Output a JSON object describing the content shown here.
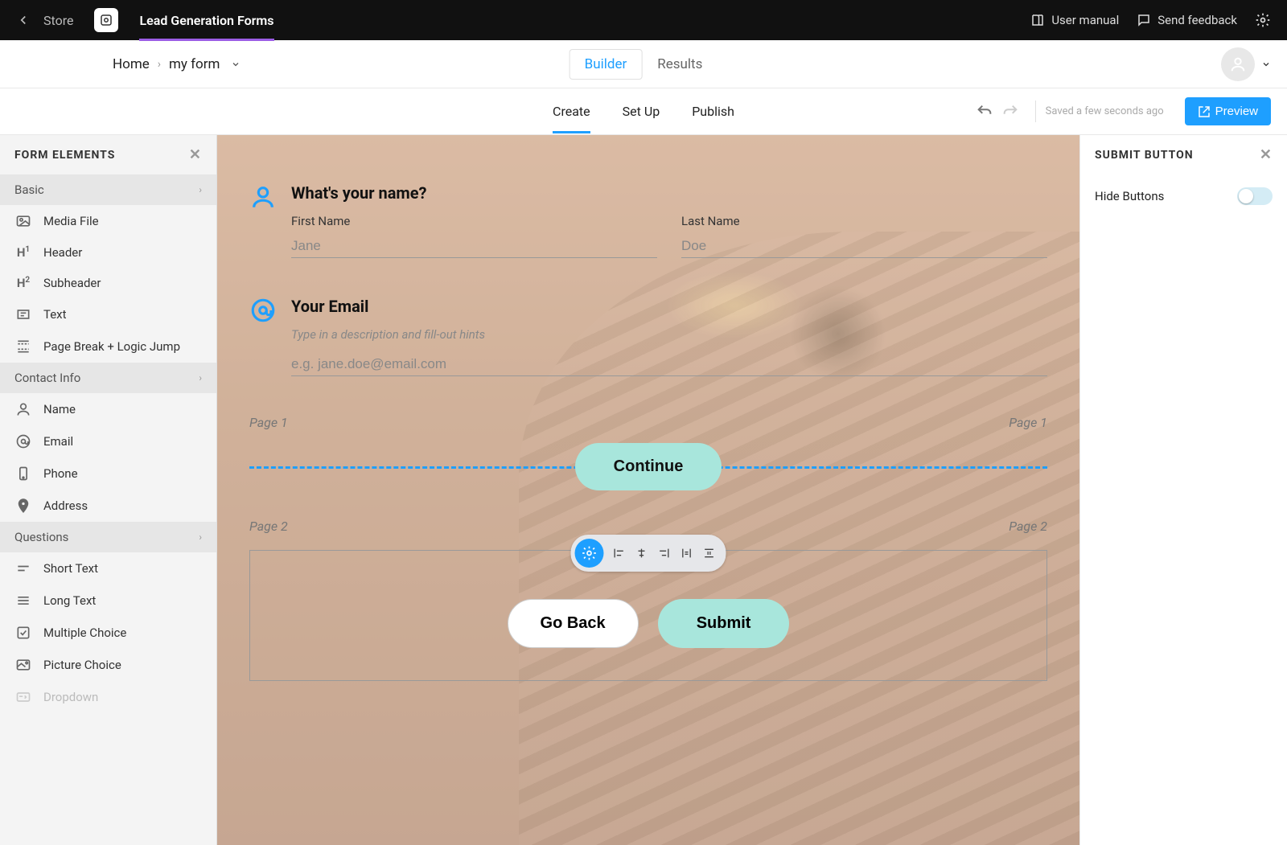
{
  "topbar": {
    "store": "Store",
    "appTitle": "Lead Generation Forms",
    "userManual": "User manual",
    "sendFeedback": "Send feedback"
  },
  "breadcrumb": {
    "home": "Home",
    "formName": "my form"
  },
  "centerTabs": {
    "builder": "Builder",
    "results": "Results"
  },
  "buildTabs": {
    "create": "Create",
    "setup": "Set Up",
    "publish": "Publish"
  },
  "status": {
    "savedText": "Saved a few seconds ago",
    "preview": "Preview"
  },
  "leftPanel": {
    "title": "FORM ELEMENTS",
    "sections": {
      "basic": "Basic",
      "contactInfo": "Contact Info",
      "questions": "Questions"
    },
    "basicItems": {
      "mediaFile": "Media File",
      "header": "Header",
      "subheader": "Subheader",
      "text": "Text",
      "pageBreak": "Page Break + Logic Jump"
    },
    "contactItems": {
      "name": "Name",
      "email": "Email",
      "phone": "Phone",
      "address": "Address"
    },
    "questionItems": {
      "shortText": "Short Text",
      "longText": "Long Text",
      "multipleChoice": "Multiple Choice",
      "pictureChoice": "Picture Choice",
      "dropdown": "Dropdown"
    }
  },
  "form": {
    "nameBlock": {
      "title": "What's your name?",
      "firstLabel": "First Name",
      "firstPlaceholder": "Jane",
      "lastLabel": "Last Name",
      "lastPlaceholder": "Doe"
    },
    "emailBlock": {
      "title": "Your Email",
      "desc": "Type in a description and fill-out hints",
      "placeholder": "e.g. jane.doe@email.com"
    },
    "page1LabelLeft": "Page 1",
    "page1LabelRight": "Page 1",
    "continue": "Continue",
    "page2LabelLeft": "Page 2",
    "page2LabelRight": "Page 2",
    "goBack": "Go Back",
    "submit": "Submit"
  },
  "rightPanel": {
    "title": "SUBMIT BUTTON",
    "hideButtons": "Hide Buttons"
  }
}
